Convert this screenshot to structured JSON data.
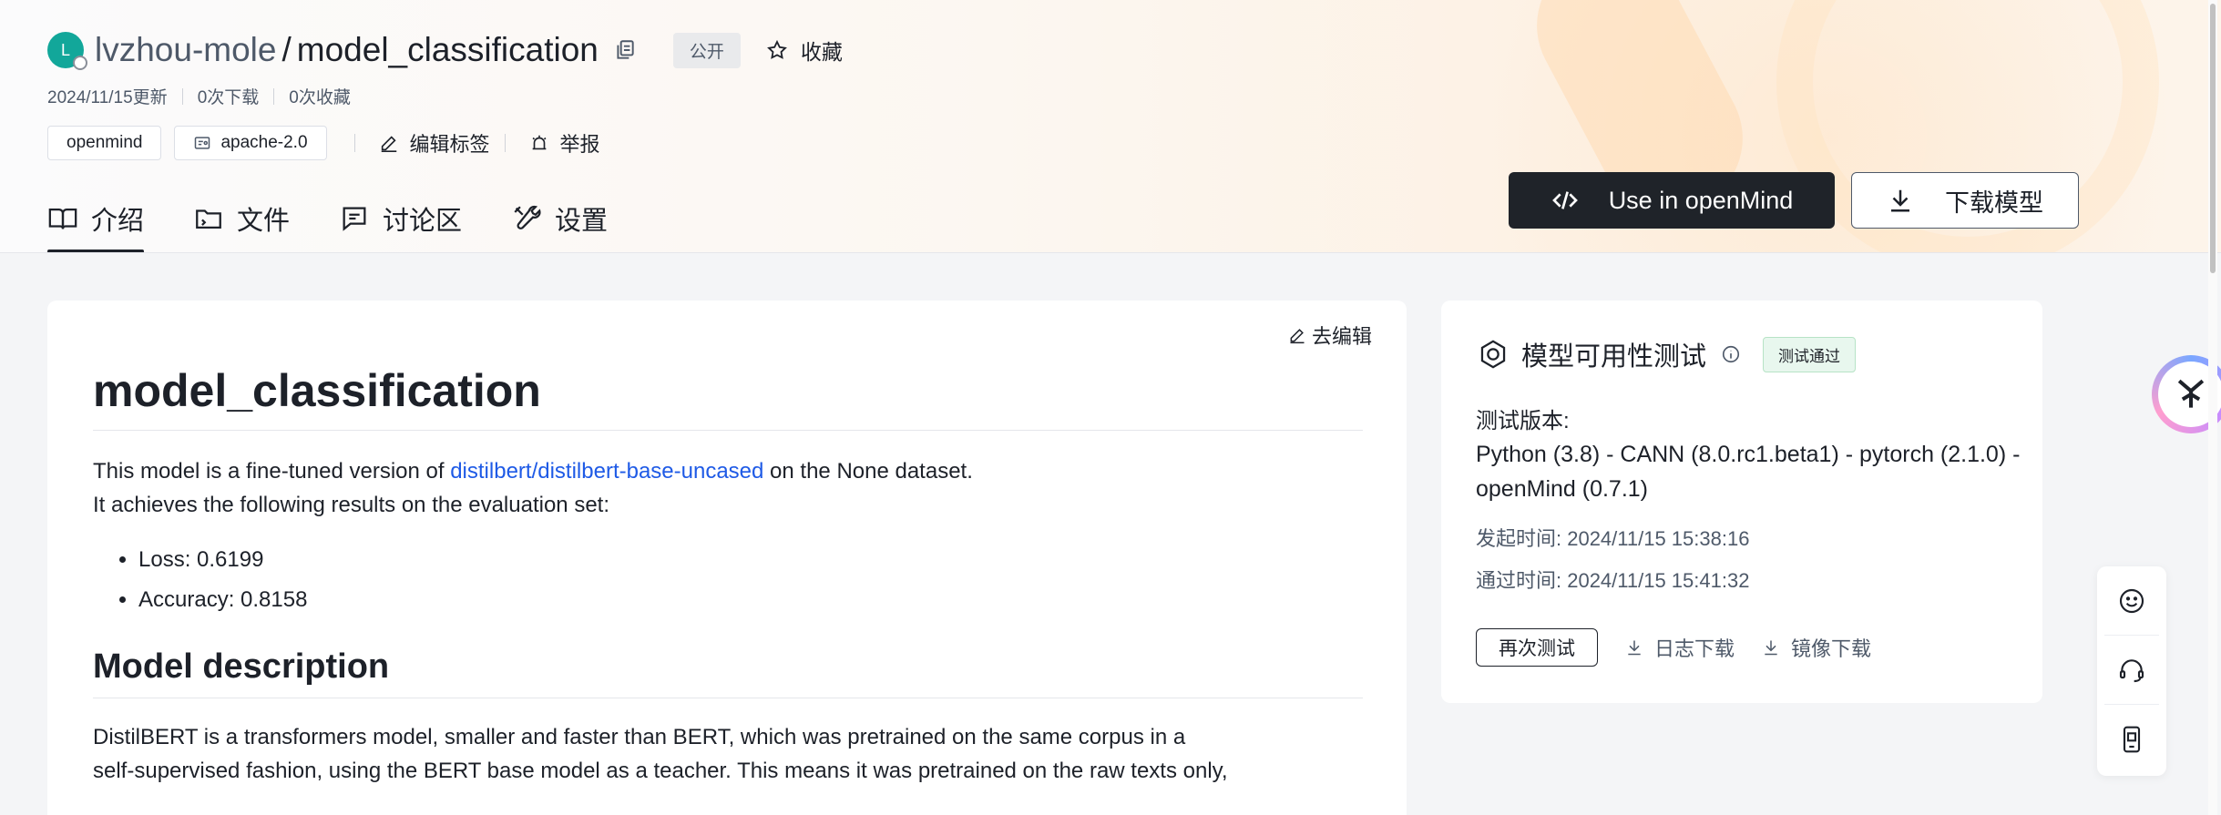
{
  "repo": {
    "avatar_letter": "L",
    "owner": "lvzhou-mole",
    "separator": "/",
    "name": "model_classification",
    "visibility": "公开",
    "favorite_label": "收藏",
    "updated": "2024/11/15更新",
    "downloads": "0次下载",
    "favorites": "0次收藏"
  },
  "tags": {
    "items": [
      "openmind",
      "apache-2.0"
    ],
    "edit_label": "编辑标签",
    "report_label": "举报"
  },
  "tabs": [
    {
      "label": "介绍",
      "icon": "book-icon",
      "active": true
    },
    {
      "label": "文件",
      "icon": "folder-icon",
      "active": false
    },
    {
      "label": "讨论区",
      "icon": "chat-icon",
      "active": false
    },
    {
      "label": "设置",
      "icon": "tools-icon",
      "active": false
    }
  ],
  "actions": {
    "use_openmind": "Use in openMind",
    "download_model": "下载模型"
  },
  "readme": {
    "edit_label": "去编辑",
    "title": "model_classification",
    "intro_prefix": "This model is a fine-tuned version of ",
    "intro_link": "distilbert/distilbert-base-uncased",
    "intro_suffix": " on the None dataset.",
    "intro_line2": "It achieves the following results on the evaluation set:",
    "metrics": [
      "Loss: 0.6199",
      "Accuracy: 0.8158"
    ],
    "section_title": "Model description",
    "description_line1": "DistilBERT is a transformers model, smaller and faster than BERT, which was pretrained on the same corpus in a",
    "description_line2": "self-supervised fashion, using the BERT base model as a teacher. This means it was pretrained on the raw texts only,"
  },
  "availability": {
    "title": "模型可用性测试",
    "status": "测试通过",
    "version_label": "测试版本:",
    "version_value": "Python (3.8) - CANN (8.0.rc1.beta1) - pytorch (2.1.0) - openMind (0.7.1)",
    "start_time": "发起时间:  2024/11/15 15:38:16",
    "pass_time": "通过时间:  2024/11/15 15:41:32",
    "retest_label": "再次测试",
    "log_download": "日志下载",
    "image_download": "镜像下载"
  },
  "colors": {
    "avatar": "#12a79a",
    "link": "#1e5ae6",
    "dark_button": "#1f2329",
    "pass_badge_bg": "#e8f7ee"
  }
}
